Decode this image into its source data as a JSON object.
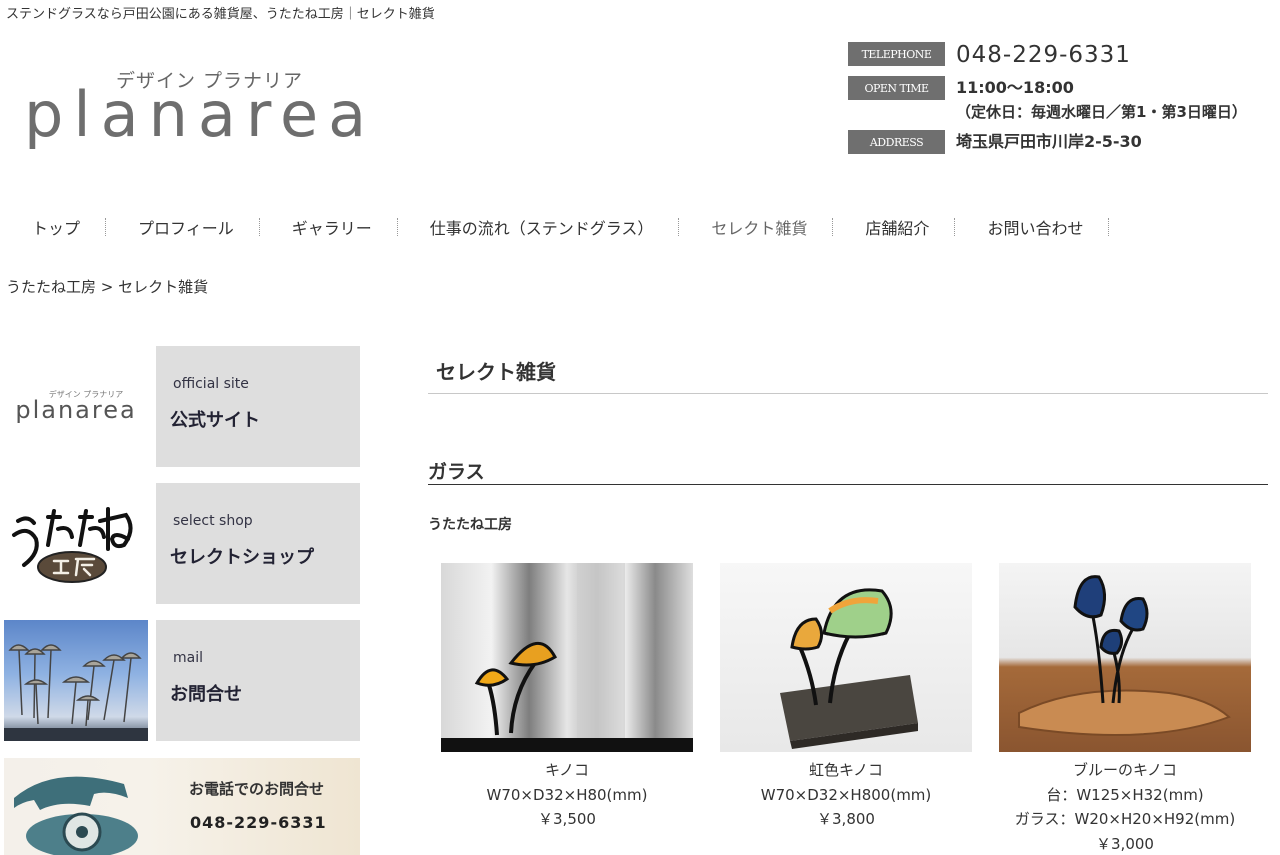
{
  "site": {
    "tagline": "ステンドグラスなら戸田公園にある雑貨屋、うたたね工房｜セレクト雑貨",
    "logo_kana": "デザイン プラナリア",
    "logo_word": "planarea"
  },
  "contact": {
    "telephone_label": "TELEPHONE",
    "telephone": "048-229-6331",
    "open_label": "OPEN TIME",
    "open_hours": "11:00〜18:00",
    "closed_days": "（定休日：毎週水曜日／第1・第3日曜日）",
    "address_label": "ADDRESS",
    "address": "埼玉県戸田市川岸2-5-30"
  },
  "nav": {
    "items": [
      {
        "label": "トップ"
      },
      {
        "label": "プロフィール"
      },
      {
        "label": "ギャラリー"
      },
      {
        "label": "仕事の流れ（ステンドグラス）"
      },
      {
        "label": "セレクト雑貨"
      },
      {
        "label": "店舗紹介"
      },
      {
        "label": "お問い合わせ"
      }
    ]
  },
  "breadcrumb": "うたたね工房 > セレクト雑貨",
  "sidebar": {
    "banners": [
      {
        "en": "official site",
        "ja": "公式サイト",
        "thumb_kana": "デザイン プラナリア",
        "thumb_word": "planarea"
      },
      {
        "en": "select shop",
        "ja": "セレクトショップ"
      },
      {
        "en": "mail",
        "ja": "お問合せ"
      }
    ],
    "tel_banner": {
      "title": "お電話でのお問合せ",
      "number": "048-229-6331"
    }
  },
  "main": {
    "title": "セレクト雑貨",
    "section": "ガラス",
    "shop": "うたたね工房",
    "products": [
      {
        "name": "キノコ",
        "size": "W70×D32×H80(mm)",
        "price": "￥3,500"
      },
      {
        "name": "虹色キノコ",
        "size": "W70×D32×H800(mm)",
        "price": "￥3,800"
      },
      {
        "name": "ブルーのキノコ",
        "size": "台：W125×H32(mm)",
        "size2": "ガラス：W20×H20×H92(mm)",
        "price": "￥3,000"
      }
    ]
  }
}
